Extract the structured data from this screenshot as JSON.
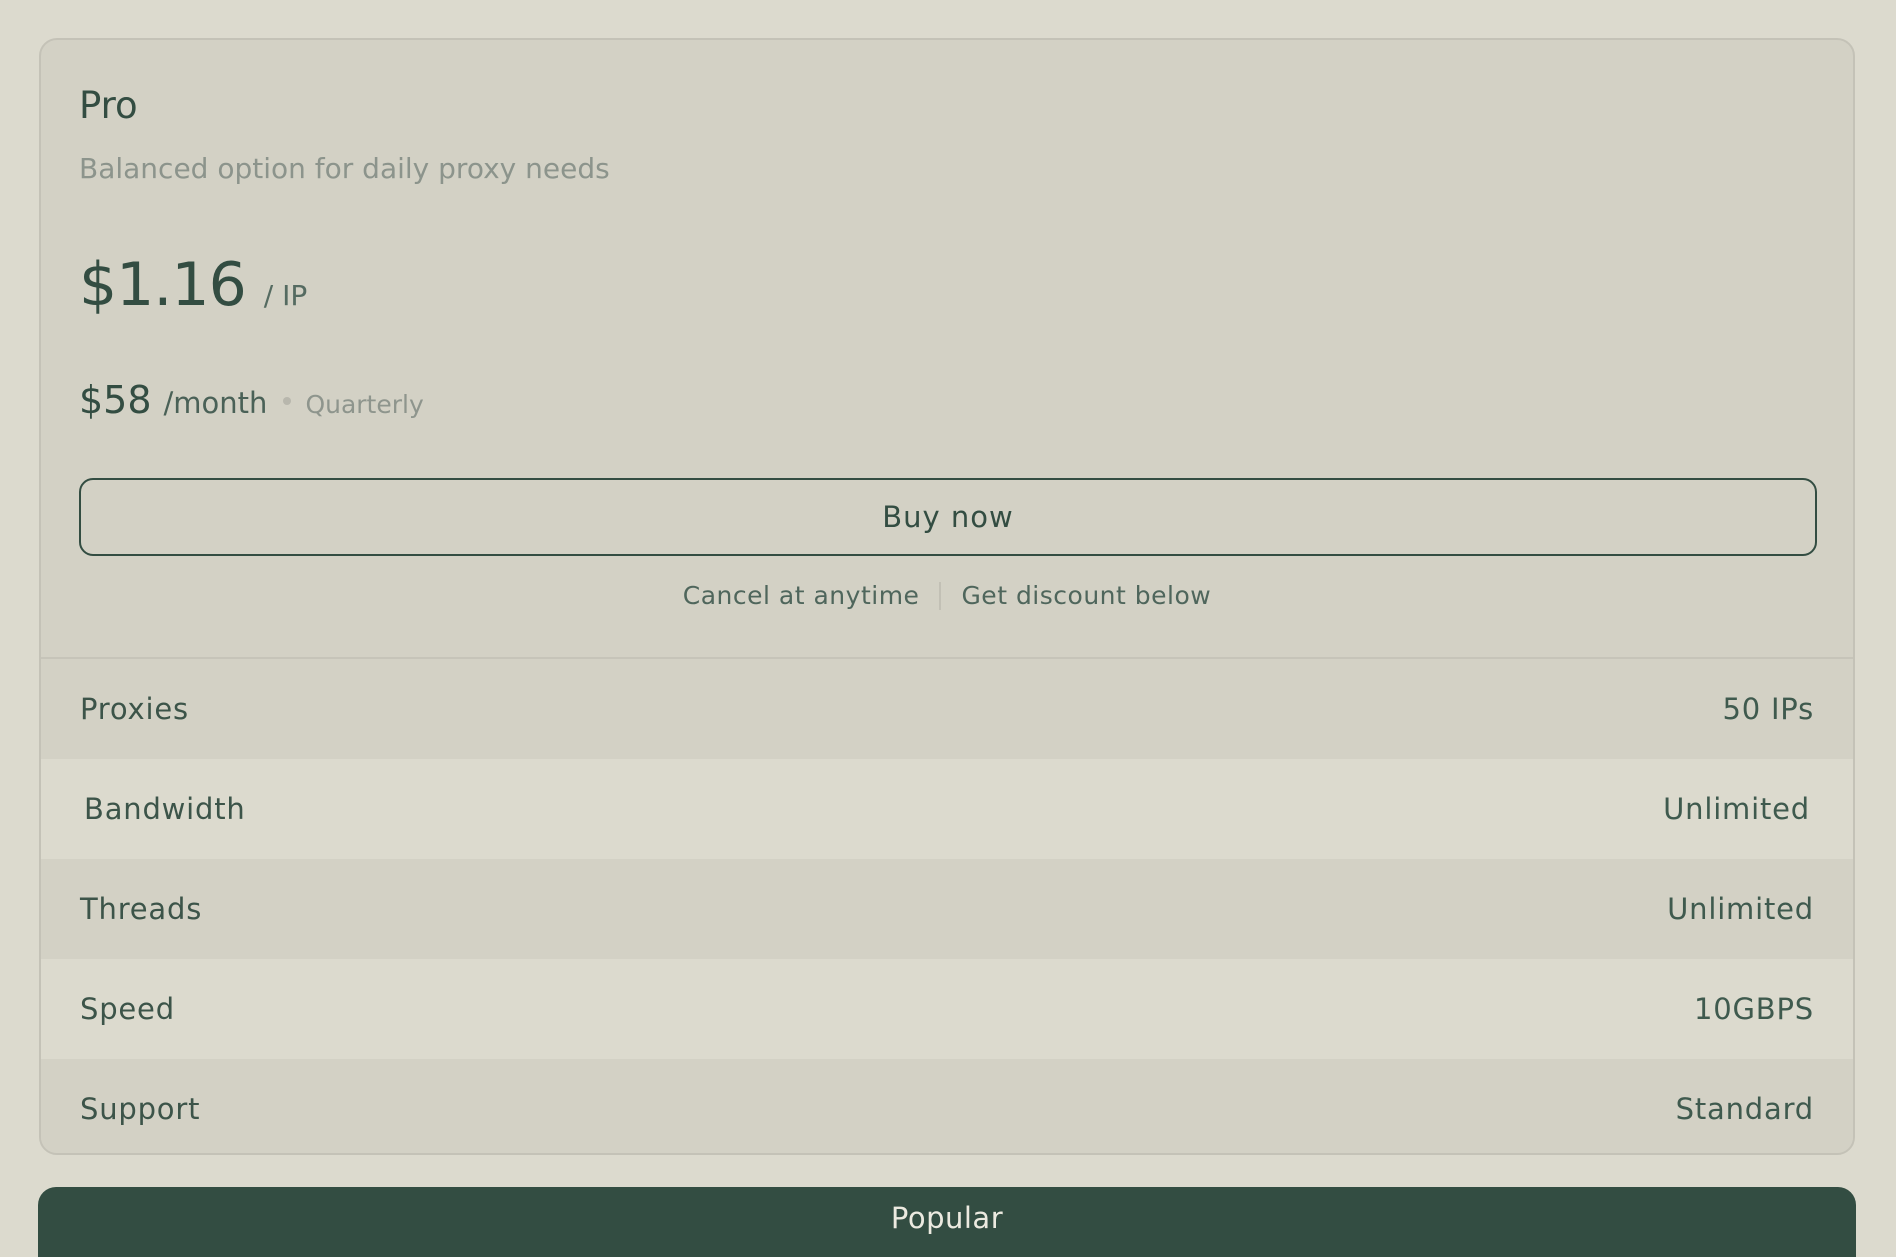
{
  "plan": {
    "name": "Pro",
    "description": "Balanced option for daily proxy needs",
    "price": "$1.16",
    "price_unit": "/ IP",
    "monthly_price": "$58",
    "monthly_unit": "/month",
    "billing_period": "Quarterly",
    "buy_label": "Buy now",
    "cancel_note": "Cancel at anytime",
    "discount_note": "Get discount below"
  },
  "features": [
    {
      "label": "Proxies",
      "value": "50 IPs"
    },
    {
      "label": "Bandwidth",
      "value": "Unlimited"
    },
    {
      "label": "Threads",
      "value": "Unlimited"
    },
    {
      "label": "Speed",
      "value": "10GBPS"
    },
    {
      "label": "Support",
      "value": "Standard"
    }
  ],
  "next_card": {
    "badge": "Popular"
  },
  "colors": {
    "page_background": "#dcdace",
    "card_background": "#d3d1c5",
    "accent": "#334d42",
    "muted_text": "#8c948c"
  }
}
